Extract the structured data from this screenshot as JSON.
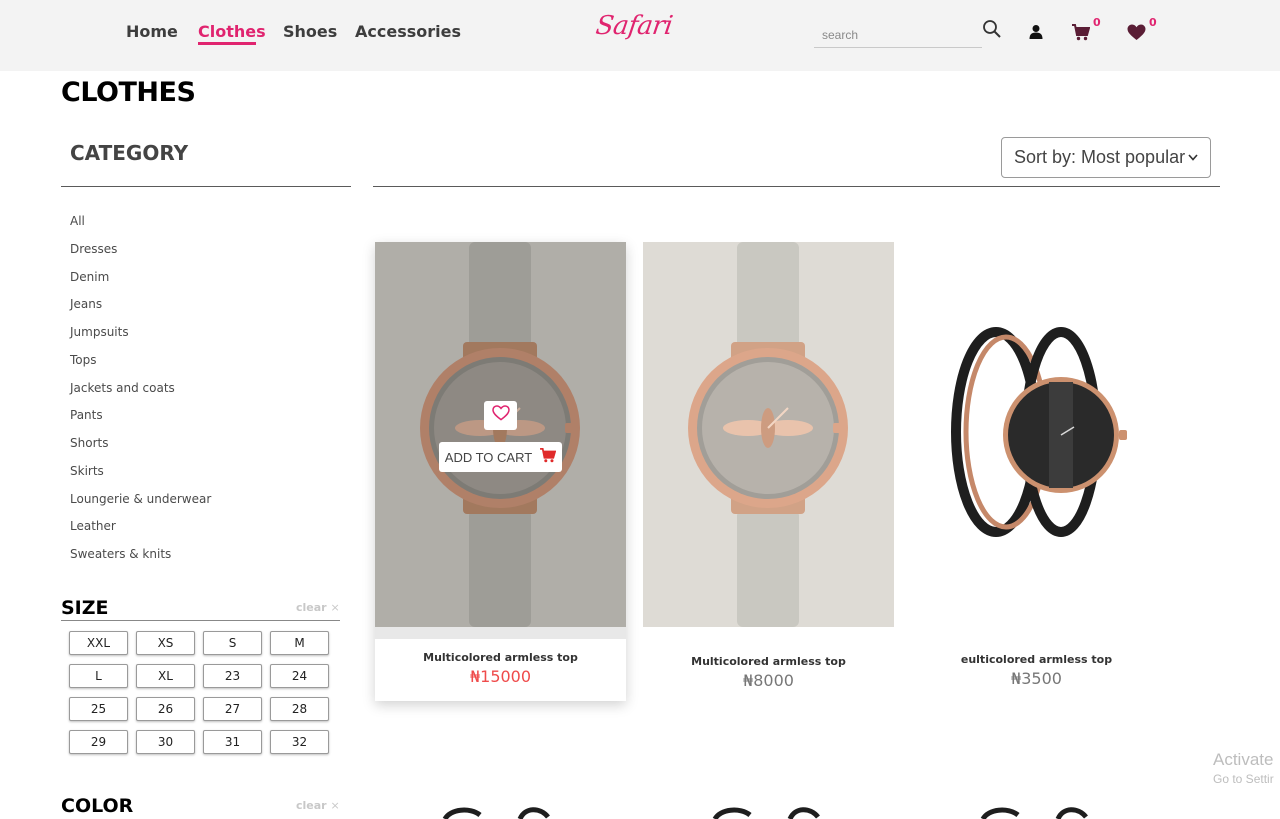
{
  "header": {
    "nav": [
      {
        "label": "Home",
        "active": false
      },
      {
        "label": "Clothes",
        "active": true
      },
      {
        "label": "Shoes",
        "active": false
      },
      {
        "label": "Accessories",
        "active": false
      }
    ],
    "logo_text": "Safari",
    "search_placeholder": "search",
    "icons": [
      "search-icon",
      "user-icon",
      "cart-icon",
      "heart-icon"
    ],
    "cart_count": "0",
    "wishlist_count": "0",
    "accent_color": "#e0246f"
  },
  "page": {
    "title": "CLOTHES"
  },
  "sidebar": {
    "category_title": "CATEGORY",
    "categories": [
      "All",
      "Dresses",
      "Denim",
      "Jeans",
      "Jumpsuits",
      "Tops",
      "Jackets and coats",
      "Pants",
      "Shorts",
      "Skirts",
      "Loungerie & underwear",
      "Leather",
      "Sweaters & knits"
    ],
    "size_title": "SIZE",
    "size_clear": "clear",
    "sizes": [
      "XXL",
      "XS",
      "S",
      "M",
      "L",
      "XL",
      "23",
      "24",
      "25",
      "26",
      "27",
      "28",
      "29",
      "30",
      "31",
      "32"
    ],
    "color_title": "COLOR",
    "color_clear": "clear"
  },
  "toolbar": {
    "sort_label": "Sort by: Most popular"
  },
  "products": [
    {
      "name": "Multicolored armless top",
      "price": "₦15000",
      "hovered": true,
      "image": "rose-gold-bee-watch"
    },
    {
      "name": "Multicolored armless top",
      "price": "₦8000",
      "hovered": false,
      "image": "rose-gold-bee-watch"
    },
    {
      "name": "eulticolored armless top",
      "price": "₦3500",
      "hovered": false,
      "image": "black-bangle-watch"
    }
  ],
  "hover_actions": {
    "add_to_cart_label": "ADD TO CART",
    "wishlist_icon": "heart-outline-icon",
    "cart_icon": "cart-icon"
  },
  "watermark": {
    "line1": "Activate",
    "line2": "Go to Settir"
  }
}
